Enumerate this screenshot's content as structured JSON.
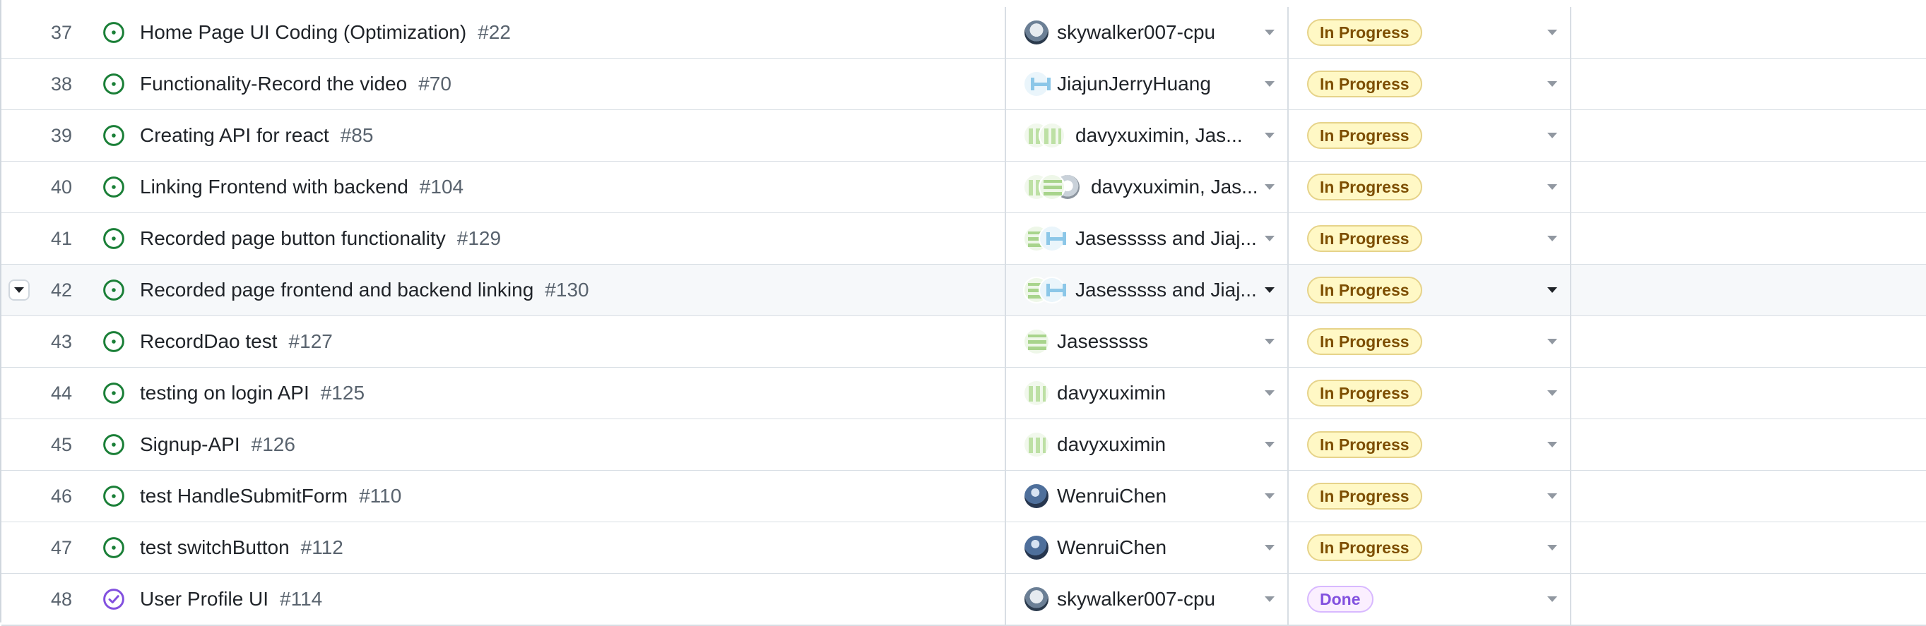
{
  "rows": [
    {
      "num": "37",
      "title": "Home Page UI Coding (Optimization)",
      "issue": "#22",
      "state": "open",
      "assignees": [
        "skywalker007-cpu"
      ],
      "avatars": [
        "sky"
      ],
      "status": "In Progress"
    },
    {
      "num": "38",
      "title": "Functionality-Record the video",
      "issue": "#70",
      "state": "open",
      "assignees": [
        "JiajunJerryHuang"
      ],
      "avatars": [
        "jia"
      ],
      "status": "In Progress"
    },
    {
      "num": "39",
      "title": "Creating API for react",
      "issue": "#85",
      "state": "open",
      "assignees": [
        "davyxuximin, Jas..."
      ],
      "avatars": [
        "davy",
        "davy"
      ],
      "status": "In Progress"
    },
    {
      "num": "40",
      "title": "Linking Frontend with backend",
      "issue": "#104",
      "state": "open",
      "assignees": [
        "davyxuximin, Jas..."
      ],
      "avatars": [
        "davy",
        "jases",
        "gray"
      ],
      "status": "In Progress"
    },
    {
      "num": "41",
      "title": "Recorded page button functionality",
      "issue": "#129",
      "state": "open",
      "assignees": [
        "Jasesssss and Jiaj..."
      ],
      "avatars": [
        "jases",
        "jia"
      ],
      "status": "In Progress"
    },
    {
      "num": "42",
      "title": "Recorded page frontend and backend linking",
      "issue": "#130",
      "state": "open",
      "assignees": [
        "Jasesssss and Jiaj..."
      ],
      "avatars": [
        "jases",
        "jia"
      ],
      "status": "In Progress"
    },
    {
      "num": "43",
      "title": "RecordDao test",
      "issue": "#127",
      "state": "open",
      "assignees": [
        "Jasesssss"
      ],
      "avatars": [
        "jases"
      ],
      "status": "In Progress"
    },
    {
      "num": "44",
      "title": "testing on login API",
      "issue": "#125",
      "state": "open",
      "assignees": [
        "davyxuximin"
      ],
      "avatars": [
        "davy"
      ],
      "status": "In Progress"
    },
    {
      "num": "45",
      "title": "Signup-API",
      "issue": "#126",
      "state": "open",
      "assignees": [
        "davyxuximin"
      ],
      "avatars": [
        "davy"
      ],
      "status": "In Progress"
    },
    {
      "num": "46",
      "title": "test HandleSubmitForm",
      "issue": "#110",
      "state": "open",
      "assignees": [
        "WenruiChen"
      ],
      "avatars": [
        "wen"
      ],
      "status": "In Progress"
    },
    {
      "num": "47",
      "title": "test switchButton",
      "issue": "#112",
      "state": "open",
      "assignees": [
        "WenruiChen"
      ],
      "avatars": [
        "wen"
      ],
      "status": "In Progress"
    },
    {
      "num": "48",
      "title": "User Profile UI",
      "issue": "#114",
      "state": "closed",
      "assignees": [
        "skywalker007-cpu"
      ],
      "avatars": [
        "sky"
      ],
      "status": "Done"
    }
  ],
  "hovered_row": "42",
  "icons": {
    "open_issue": "issue-opened-icon",
    "closed_issue": "issue-closed-icon",
    "dropdown": "triangle-down-icon",
    "expand": "row-expand-icon"
  },
  "colors": {
    "open": "#1a7f37",
    "closed": "#8250df",
    "in_progress_bg": "#fff8c5",
    "done_bg": "#fbefff"
  }
}
